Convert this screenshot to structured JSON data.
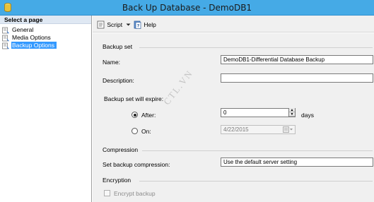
{
  "window": {
    "title": "Back Up Database - DemoDB1"
  },
  "left_pane": {
    "header": "Select a page",
    "items": [
      {
        "label": "General",
        "selected": false
      },
      {
        "label": "Media Options",
        "selected": false
      },
      {
        "label": "Backup Options",
        "selected": true
      }
    ]
  },
  "toolbar": {
    "script_label": "Script",
    "help_label": "Help"
  },
  "backup_set": {
    "section_label": "Backup set",
    "name_label": "Name:",
    "name_value": "DemoDB1-Differential Database Backup",
    "description_label": "Description:",
    "description_value": "",
    "expire_label": "Backup set will expire:",
    "after_label": "After:",
    "after_value": "0",
    "days_label": "days",
    "on_label": "On:",
    "on_value": "4/22/2015"
  },
  "compression": {
    "section_label": "Compression",
    "set_label": "Set backup compression:",
    "value": "Use the default server setting"
  },
  "encryption": {
    "section_label": "Encryption",
    "encrypt_label": "Encrypt backup"
  },
  "watermark": "CTL.VN"
}
